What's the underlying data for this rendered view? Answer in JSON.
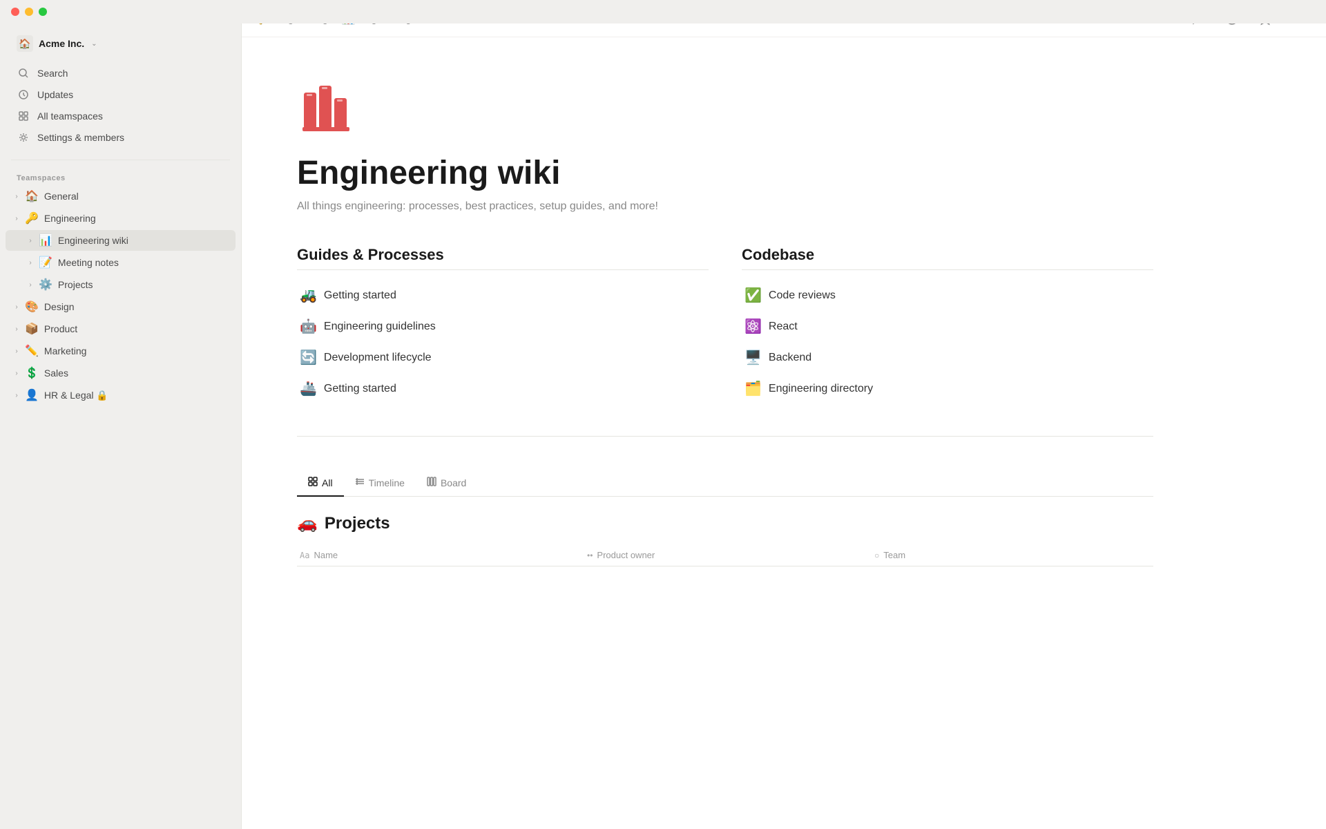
{
  "window": {
    "title": "Engineering wiki"
  },
  "breadcrumb": {
    "parent_emoji": "🔑",
    "parent_label": "Engineering",
    "separator": "/",
    "current_emoji": "📊",
    "current_label": "Engineering wiki"
  },
  "topbar_actions": {
    "comment_icon": "💬",
    "info_icon": "ℹ",
    "star_icon": "☆",
    "more_icon": "•••"
  },
  "sidebar": {
    "workspace": {
      "name": "Acme Inc.",
      "chevron": "⌄"
    },
    "nav_items": [
      {
        "id": "home",
        "icon": "home",
        "label": "Acme Inc.",
        "emoji": null
      },
      {
        "id": "search",
        "icon": "search",
        "label": "Search"
      },
      {
        "id": "updates",
        "icon": "clock",
        "label": "Updates"
      },
      {
        "id": "all-teamspaces",
        "icon": "grid",
        "label": "All teamspaces"
      },
      {
        "id": "settings",
        "icon": "gear",
        "label": "Settings & members"
      }
    ],
    "teamspaces_label": "Teamspaces",
    "teamspaces": [
      {
        "id": "general",
        "emoji": "🏠",
        "label": "General"
      },
      {
        "id": "engineering",
        "emoji": "🔑",
        "label": "Engineering"
      }
    ],
    "engineering_children": [
      {
        "id": "engineering-wiki",
        "emoji": "📊",
        "label": "Engineering wiki",
        "active": true
      },
      {
        "id": "meeting-notes",
        "emoji": "📝",
        "label": "Meeting notes"
      },
      {
        "id": "projects",
        "emoji": "⚙️",
        "label": "Projects"
      }
    ],
    "other_teamspaces": [
      {
        "id": "design",
        "emoji": "🎨",
        "label": "Design"
      },
      {
        "id": "product",
        "emoji": "📦",
        "label": "Product"
      },
      {
        "id": "marketing",
        "emoji": "✏️",
        "label": "Marketing"
      },
      {
        "id": "sales",
        "emoji": "💲",
        "label": "Sales"
      },
      {
        "id": "hr-legal",
        "emoji": "👤",
        "label": "HR & Legal 🔒"
      }
    ]
  },
  "page": {
    "icon": "📊",
    "title": "Engineering wiki",
    "subtitle": "All things engineering: processes, best practices, setup guides, and more!"
  },
  "sections": {
    "left": {
      "title": "Guides & Processes",
      "links": [
        {
          "emoji": "🚜",
          "label": "Getting started"
        },
        {
          "emoji": "🤖",
          "label": "Engineering guidelines"
        },
        {
          "emoji": "🔄",
          "label": "Development lifecycle"
        },
        {
          "emoji": "🚢",
          "label": "Getting started"
        }
      ]
    },
    "right": {
      "title": "Codebase",
      "links": [
        {
          "emoji": "✅",
          "label": "Code reviews"
        },
        {
          "emoji": "⚛️",
          "label": "React"
        },
        {
          "emoji": "🖥️",
          "label": "Backend"
        },
        {
          "emoji": "🗂️",
          "label": "Engineering directory"
        }
      ]
    }
  },
  "tabs": [
    {
      "id": "all",
      "icon": "⊞",
      "label": "All",
      "active": true
    },
    {
      "id": "timeline",
      "icon": "≡",
      "label": "Timeline",
      "active": false
    },
    {
      "id": "board",
      "icon": "⊟",
      "label": "Board",
      "active": false
    }
  ],
  "projects_section": {
    "emoji": "🚗",
    "title": "Projects",
    "table_headers": [
      {
        "icon": "Aa",
        "label": "Name"
      },
      {
        "icon": "••",
        "label": "Product owner"
      },
      {
        "icon": "○",
        "label": "Team"
      }
    ]
  }
}
